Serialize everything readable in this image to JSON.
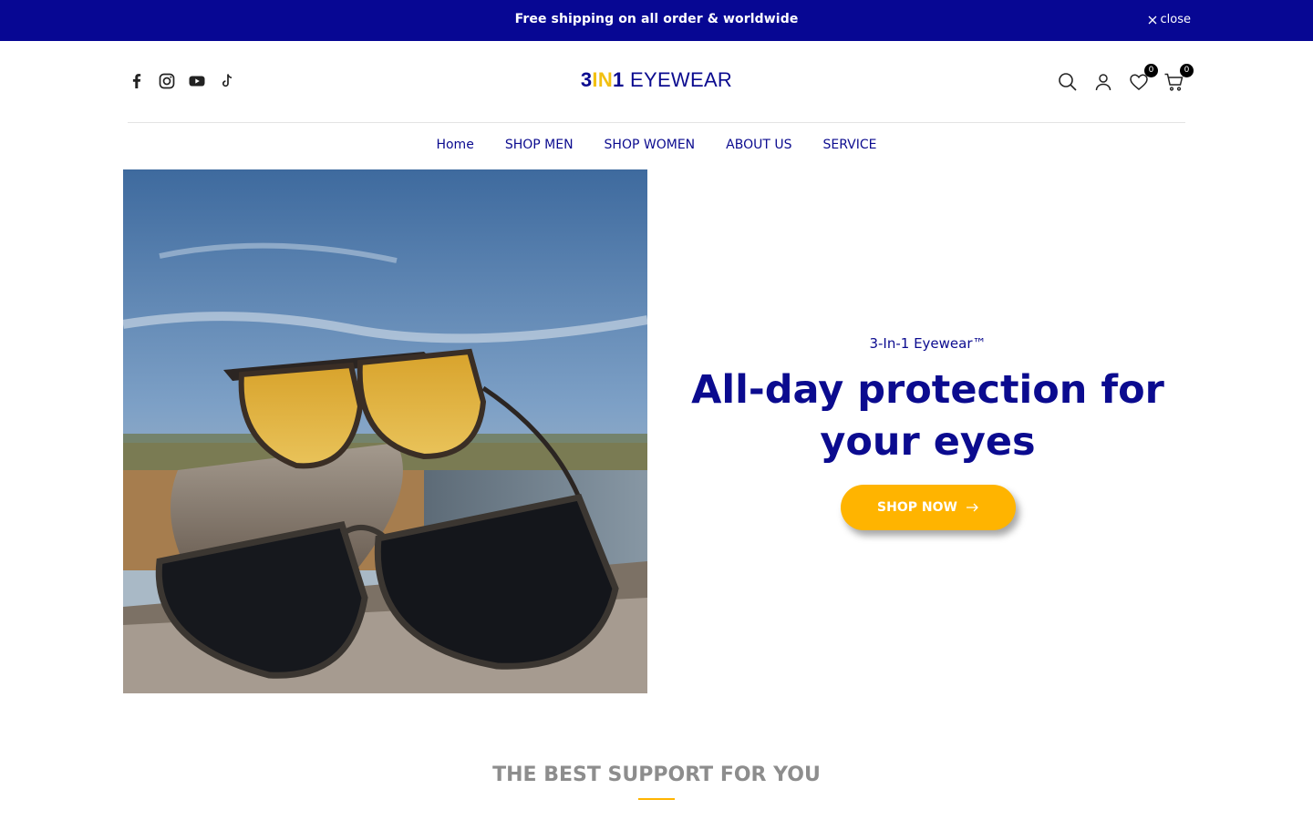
{
  "announcement": {
    "text": "Free shipping on all order & worldwide",
    "close_label": "close"
  },
  "header": {
    "logo": {
      "num_a": "3",
      "in": "IN",
      "num_b": "1",
      "word": " EYEWEAR"
    },
    "socials": [
      "facebook-icon",
      "instagram-icon",
      "youtube-icon",
      "tiktok-icon"
    ],
    "wishlist_count": "0",
    "cart_count": "0"
  },
  "nav": {
    "items": [
      {
        "label": "Home"
      },
      {
        "label": "SHOP MEN"
      },
      {
        "label": "SHOP WOMEN"
      },
      {
        "label": "ABOUT US"
      },
      {
        "label": "SERVICE"
      }
    ]
  },
  "hero": {
    "subtitle": "3-In-1 Eyewear™",
    "title": "All-day protection for your eyes",
    "button_label": "SHOP NOW"
  },
  "section": {
    "title": "THE BEST SUPPORT FOR YOU"
  },
  "colors": {
    "brand_navy": "#070793",
    "accent_yellow": "#ffb400",
    "logo_gold": "#f2c012"
  }
}
